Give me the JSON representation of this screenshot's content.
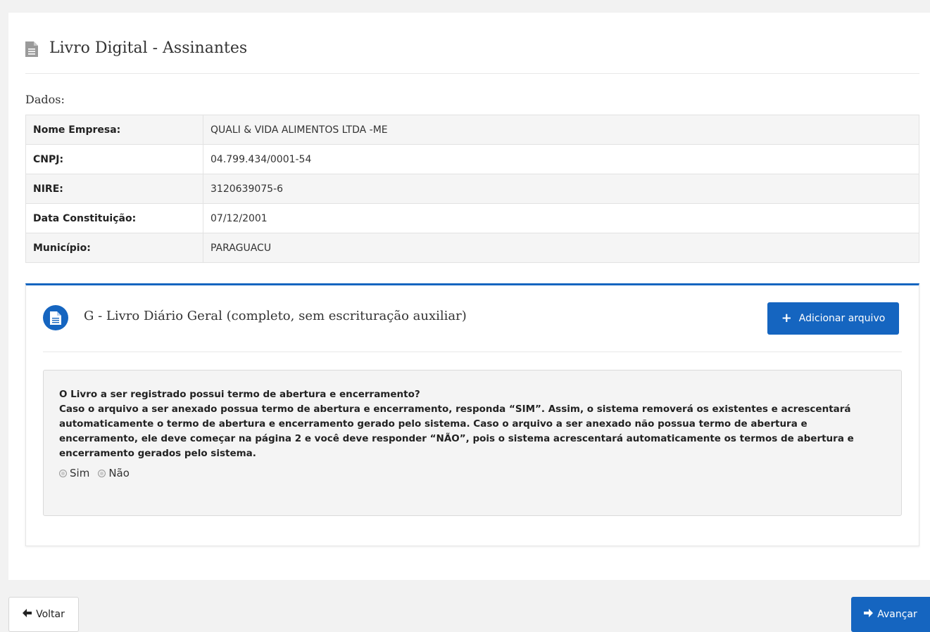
{
  "header": {
    "title": "Livro Digital - Assinantes",
    "icon": "file-text-icon"
  },
  "dados": {
    "label": "Dados:",
    "rows": [
      {
        "key": "Nome Empresa:",
        "value": "QUALI & VIDA ALIMENTOS LTDA -ME"
      },
      {
        "key": "CNPJ:",
        "value": "04.799.434/0001-54"
      },
      {
        "key": "NIRE:",
        "value": "3120639075-6"
      },
      {
        "key": "Data Constituição:",
        "value": "07/12/2001"
      },
      {
        "key": "Município:",
        "value": "PARAGUACU"
      }
    ]
  },
  "book": {
    "title": "G - Livro Diário Geral (completo, sem escrituração auxiliar)",
    "icon": "file-text-icon",
    "add_button_label": "Adicionar arquivo",
    "question_lines": [
      "O Livro a ser registrado possui termo de abertura e encerramento?",
      "Caso o arquivo a ser anexado possua termo de abertura e encerramento, responda “SIM”. Assim, o sistema removerá os existentes e acrescentará automaticamente o termo de abertura e encerramento gerado pelo sistema. Caso o arquivo a ser anexado não possua termo de abertura e encerramento, ele deve começar na página 2 e você deve responder “NÃO”, pois o sistema acrescentará automaticamente os termos de abertura e encerramento gerados pelo sistema."
    ],
    "options": [
      "Sim",
      "Não"
    ]
  },
  "footer": {
    "back_label": "Voltar",
    "next_label": "Avançar"
  },
  "colors": {
    "accent": "#1565c0",
    "background": "#f2f2f2"
  }
}
